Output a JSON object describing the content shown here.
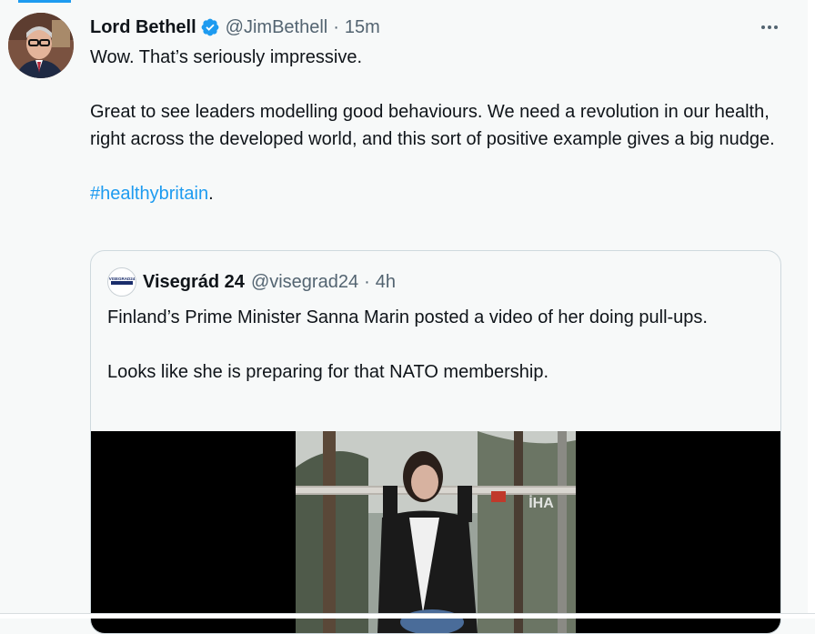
{
  "tweet": {
    "author_name": "Lord Bethell",
    "handle": "@JimBethell",
    "separator": "·",
    "time": "15m",
    "paragraphs": [
      "Wow. That’s seriously impressive.",
      "Great to see leaders modelling good behaviours. We need a revolution in our health, right across the developed world, and this sort of positive example gives a big nudge."
    ],
    "hashtag": "#healthybritain",
    "hashtag_suffix": ".",
    "icons": {
      "verified": "verified-badge-icon",
      "more": "more-options-icon"
    },
    "colors": {
      "accent": "#1d9bf0",
      "secondary_text": "#536471"
    }
  },
  "quote": {
    "author_name": "Visegrád 24",
    "handle": "@visegrad24",
    "separator": "·",
    "time": "4h",
    "avatar_text": "VISEGRAD24",
    "paragraphs": [
      "Finland’s Prime Minister Sanna Marin posted a video of her doing pull-ups.",
      "Looks like she is preparing for that NATO membership."
    ],
    "video_watermark": "İHA"
  }
}
